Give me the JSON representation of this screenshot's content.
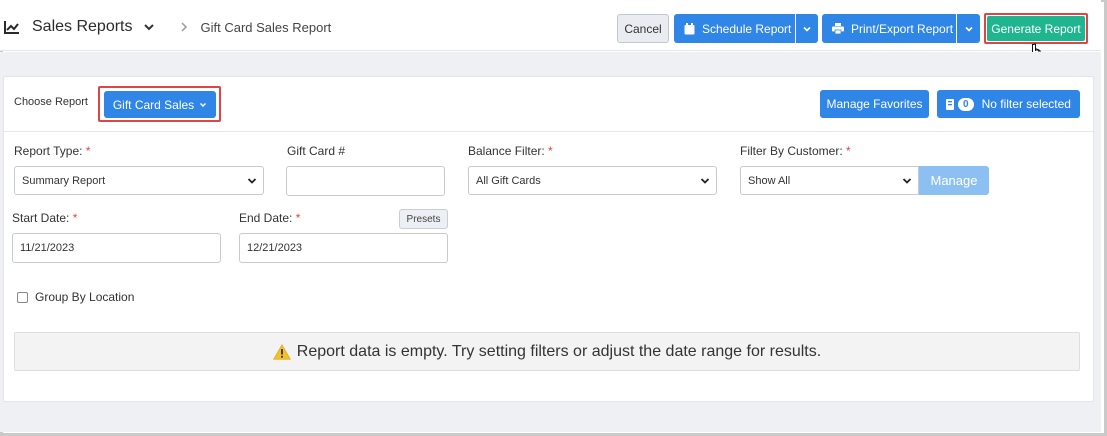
{
  "header": {
    "title": "Sales Reports",
    "breadcrumb_current": "Gift Card Sales Report",
    "cancel_label": "Cancel",
    "schedule_label": "Schedule Report",
    "print_label": "Print/Export Report",
    "generate_label": "Generate Report"
  },
  "toolbar": {
    "choose_label": "Choose Report",
    "selected_report": "Gift Card Sales",
    "manage_favorites_label": "Manage Favorites",
    "filter_count": "0",
    "filter_label": "No filter selected"
  },
  "form": {
    "report_type_label": "Report Type:",
    "report_type_value": "Summary Report",
    "gift_card_label": "Gift Card #",
    "gift_card_value": "",
    "balance_filter_label": "Balance Filter:",
    "balance_filter_value": "All Gift Cards",
    "customer_filter_label": "Filter By Customer:",
    "customer_filter_value": "Show All",
    "manage_label": "Manage",
    "start_date_label": "Start Date:",
    "start_date_value": "11/21/2023",
    "end_date_label": "End Date:",
    "end_date_value": "12/21/2023",
    "presets_label": "Presets",
    "group_by_location_label": "Group By Location",
    "required_mark": "*"
  },
  "message": {
    "empty_text": "Report data is empty. Try setting filters or adjust the date range for results."
  },
  "colors": {
    "primary": "#2f86e6",
    "generate": "#1fb58f",
    "highlight": "#e04444",
    "warning": "#f2c12e"
  }
}
